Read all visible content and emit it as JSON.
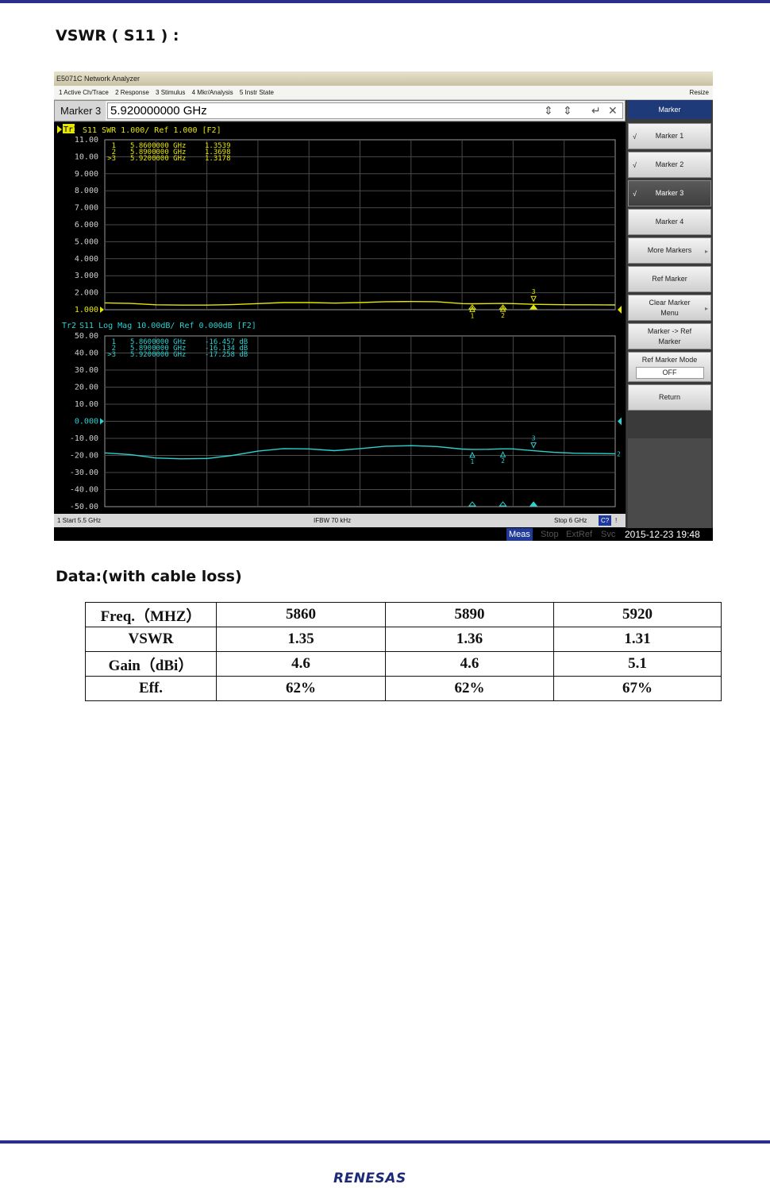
{
  "heading_vswr": "VSWR ( S11 ) :",
  "heading_data": "Data:(with cable loss)",
  "analyzer": {
    "window_title": "E5071C Network Analyzer",
    "menu": [
      "1 Active Ch/Trace",
      "2 Response",
      "3 Stimulus",
      "4 Mkr/Analysis",
      "5 Instr State"
    ],
    "resize_label": "Resize",
    "entry_label": "Marker 3",
    "entry_value": "5.920000000 GHz",
    "softkey_title": "Marker",
    "softkeys": [
      {
        "label": "Marker 1",
        "checked": true
      },
      {
        "label": "Marker 2",
        "checked": true
      },
      {
        "label": "Marker 3",
        "checked": true,
        "active": true
      },
      {
        "label": "Marker 4",
        "checked": false
      },
      {
        "label": "More Markers",
        "submenu": true
      },
      {
        "label": "Ref Marker"
      },
      {
        "label": "Clear Marker Menu",
        "submenu": true
      },
      {
        "label": "Marker -> Ref Marker"
      },
      {
        "label": "Ref Marker Mode",
        "value": "OFF"
      },
      {
        "label": "Return"
      }
    ],
    "status_start": "1  Start 5.5 GHz",
    "status_ifbw": "IFBW 70 kHz",
    "status_stop": "Stop 6 GHz",
    "status_cal": "C?",
    "status_bang": "!",
    "bottom": {
      "meas": "Meas",
      "stop": "Stop",
      "extref": "ExtRef",
      "svc": "Svc",
      "datetime": "2015-12-23 19:48"
    },
    "colors": {
      "trace1": "#e6e600",
      "trace2": "#2ad2d2",
      "grid": "#4a4a4a",
      "screen_bg": "#000000",
      "softkey_title_bg": "#1f3a78"
    }
  },
  "chart_data": [
    {
      "type": "line",
      "trace_label": "Tr1",
      "header": "S11  SWR 1.000/ Ref 1.000 [F2]",
      "ylim": [
        1,
        11
      ],
      "y_ticks": [
        "11.00",
        "10.00",
        "9.000",
        "8.000",
        "7.000",
        "6.000",
        "5.000",
        "4.000",
        "3.000",
        "2.000",
        "1.000"
      ],
      "xlim": [
        5.5,
        6.0
      ],
      "x_unit": "GHz",
      "series": [
        {
          "x": [
            5.5,
            5.525,
            5.55,
            5.575,
            5.6,
            5.625,
            5.65,
            5.675,
            5.7,
            5.725,
            5.75,
            5.775,
            5.8,
            5.825,
            5.85,
            5.86,
            5.875,
            5.89,
            5.9,
            5.92,
            5.94,
            5.96,
            5.975,
            6.0
          ],
          "y": [
            1.4,
            1.37,
            1.29,
            1.27,
            1.27,
            1.3,
            1.36,
            1.42,
            1.42,
            1.39,
            1.42,
            1.47,
            1.48,
            1.47,
            1.36,
            1.35,
            1.36,
            1.37,
            1.36,
            1.32,
            1.3,
            1.29,
            1.29,
            1.28
          ]
        }
      ],
      "markers": [
        {
          "id": "1",
          "freq": "5.8600000 GHz",
          "value": "1.3539",
          "x": 5.86,
          "y": 1.3539
        },
        {
          "id": "2",
          "freq": "5.8900000 GHz",
          "value": "1.3698",
          "x": 5.89,
          "y": 1.3698
        },
        {
          "id": ">3",
          "freq": "5.9200000 GHz",
          "value": "1.3178",
          "x": 5.92,
          "y": 1.3178
        }
      ]
    },
    {
      "type": "line",
      "trace_label": "Tr2",
      "header": "S11  Log Mag 10.00dB/ Ref 0.000dB [F2]",
      "ylim": [
        -50,
        50
      ],
      "y_ticks": [
        "50.00",
        "40.00",
        "30.00",
        "20.00",
        "10.00",
        "0.000",
        "-10.00",
        "-20.00",
        "-30.00",
        "-40.00",
        "-50.00"
      ],
      "xlim": [
        5.5,
        6.0
      ],
      "x_unit": "GHz",
      "series": [
        {
          "x": [
            5.5,
            5.525,
            5.55,
            5.575,
            5.6,
            5.625,
            5.65,
            5.675,
            5.7,
            5.725,
            5.75,
            5.775,
            5.8,
            5.825,
            5.85,
            5.86,
            5.875,
            5.89,
            5.9,
            5.92,
            5.94,
            5.96,
            5.975,
            6.0
          ],
          "y": [
            -18.5,
            -19.5,
            -21.5,
            -22.0,
            -21.8,
            -20.0,
            -17.5,
            -16.0,
            -16.2,
            -17.2,
            -16.0,
            -14.6,
            -14.3,
            -14.8,
            -16.3,
            -16.457,
            -16.4,
            -16.134,
            -16.2,
            -17.258,
            -18.2,
            -18.7,
            -18.8,
            -19.0
          ]
        }
      ],
      "markers": [
        {
          "id": "1",
          "freq": "5.8600000 GHz",
          "value": "-16.457 dB",
          "x": 5.86,
          "y": -16.457
        },
        {
          "id": "2",
          "freq": "5.8900000 GHz",
          "value": "-16.134 dB",
          "x": 5.89,
          "y": -16.134
        },
        {
          "id": ">3",
          "freq": "5.9200000 GHz",
          "value": "-17.258 dB",
          "x": 5.92,
          "y": -17.258
        }
      ]
    }
  ],
  "table": {
    "rows": [
      [
        "Freq.（MHZ）",
        "5860",
        "5890",
        "5920"
      ],
      [
        "VSWR",
        "1.35",
        "1.36",
        "1.31"
      ],
      [
        "Gain（dBi）",
        "4.6",
        "4.6",
        "5.1"
      ],
      [
        "Eff.",
        "62%",
        "62%",
        "67%"
      ]
    ]
  },
  "logo_text": "RENESAS"
}
